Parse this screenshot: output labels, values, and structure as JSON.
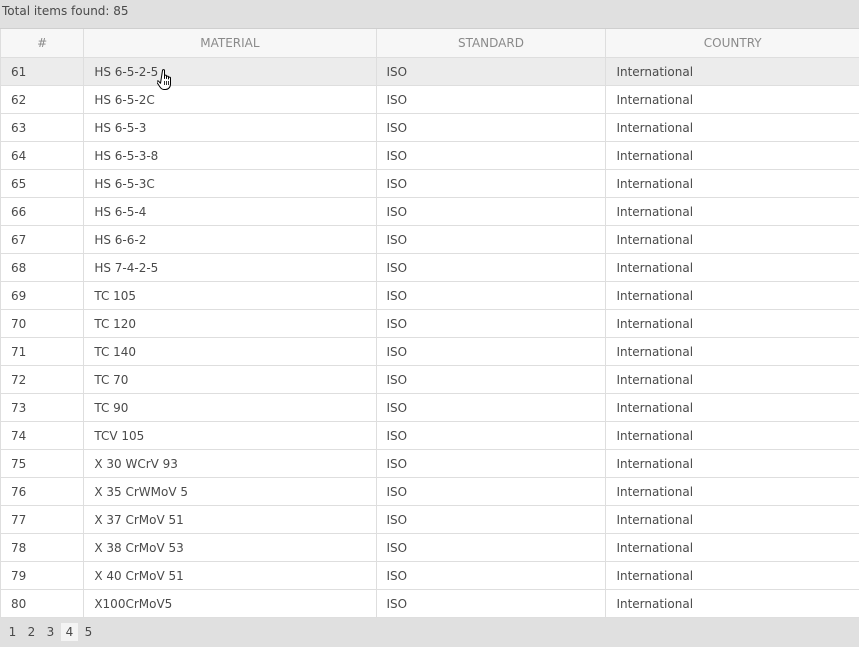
{
  "header": {
    "total_text": "Total items found: 85"
  },
  "table": {
    "columns": [
      "#",
      "MATERIAL",
      "STANDARD",
      "COUNTRY"
    ],
    "rows": [
      {
        "num": "61",
        "material": "HS 6-5-2-5",
        "standard": "ISO",
        "country": "International"
      },
      {
        "num": "62",
        "material": "HS 6-5-2C",
        "standard": "ISO",
        "country": "International"
      },
      {
        "num": "63",
        "material": "HS 6-5-3",
        "standard": "ISO",
        "country": "International"
      },
      {
        "num": "64",
        "material": "HS 6-5-3-8",
        "standard": "ISO",
        "country": "International"
      },
      {
        "num": "65",
        "material": "HS 6-5-3C",
        "standard": "ISO",
        "country": "International"
      },
      {
        "num": "66",
        "material": "HS 6-5-4",
        "standard": "ISO",
        "country": "International"
      },
      {
        "num": "67",
        "material": "HS 6-6-2",
        "standard": "ISO",
        "country": "International"
      },
      {
        "num": "68",
        "material": "HS 7-4-2-5",
        "standard": "ISO",
        "country": "International"
      },
      {
        "num": "69",
        "material": "TC 105",
        "standard": "ISO",
        "country": "International"
      },
      {
        "num": "70",
        "material": "TC 120",
        "standard": "ISO",
        "country": "International"
      },
      {
        "num": "71",
        "material": "TC 140",
        "standard": "ISO",
        "country": "International"
      },
      {
        "num": "72",
        "material": "TC 70",
        "standard": "ISO",
        "country": "International"
      },
      {
        "num": "73",
        "material": "TC 90",
        "standard": "ISO",
        "country": "International"
      },
      {
        "num": "74",
        "material": "TCV 105",
        "standard": "ISO",
        "country": "International"
      },
      {
        "num": "75",
        "material": "X 30 WCrV 93",
        "standard": "ISO",
        "country": "International"
      },
      {
        "num": "76",
        "material": "X 35 CrWMoV 5",
        "standard": "ISO",
        "country": "International"
      },
      {
        "num": "77",
        "material": "X 37 CrMoV 51",
        "standard": "ISO",
        "country": "International"
      },
      {
        "num": "78",
        "material": "X 38 CrMoV 53",
        "standard": "ISO",
        "country": "International"
      },
      {
        "num": "79",
        "material": "X 40 CrMoV 51",
        "standard": "ISO",
        "country": "International"
      },
      {
        "num": "80",
        "material": "X100CrMoV5",
        "standard": "ISO",
        "country": "International"
      }
    ],
    "hovered_row": "61"
  },
  "pagination": {
    "pages": [
      "1",
      "2",
      "3",
      "4",
      "5"
    ],
    "current": "4"
  },
  "icons": {
    "cursor": "hand-pointer-cursor-icon"
  },
  "colors": {
    "background": "#e0e0e0",
    "row_hover": "#ececec",
    "header_text": "#8a8a8a"
  }
}
